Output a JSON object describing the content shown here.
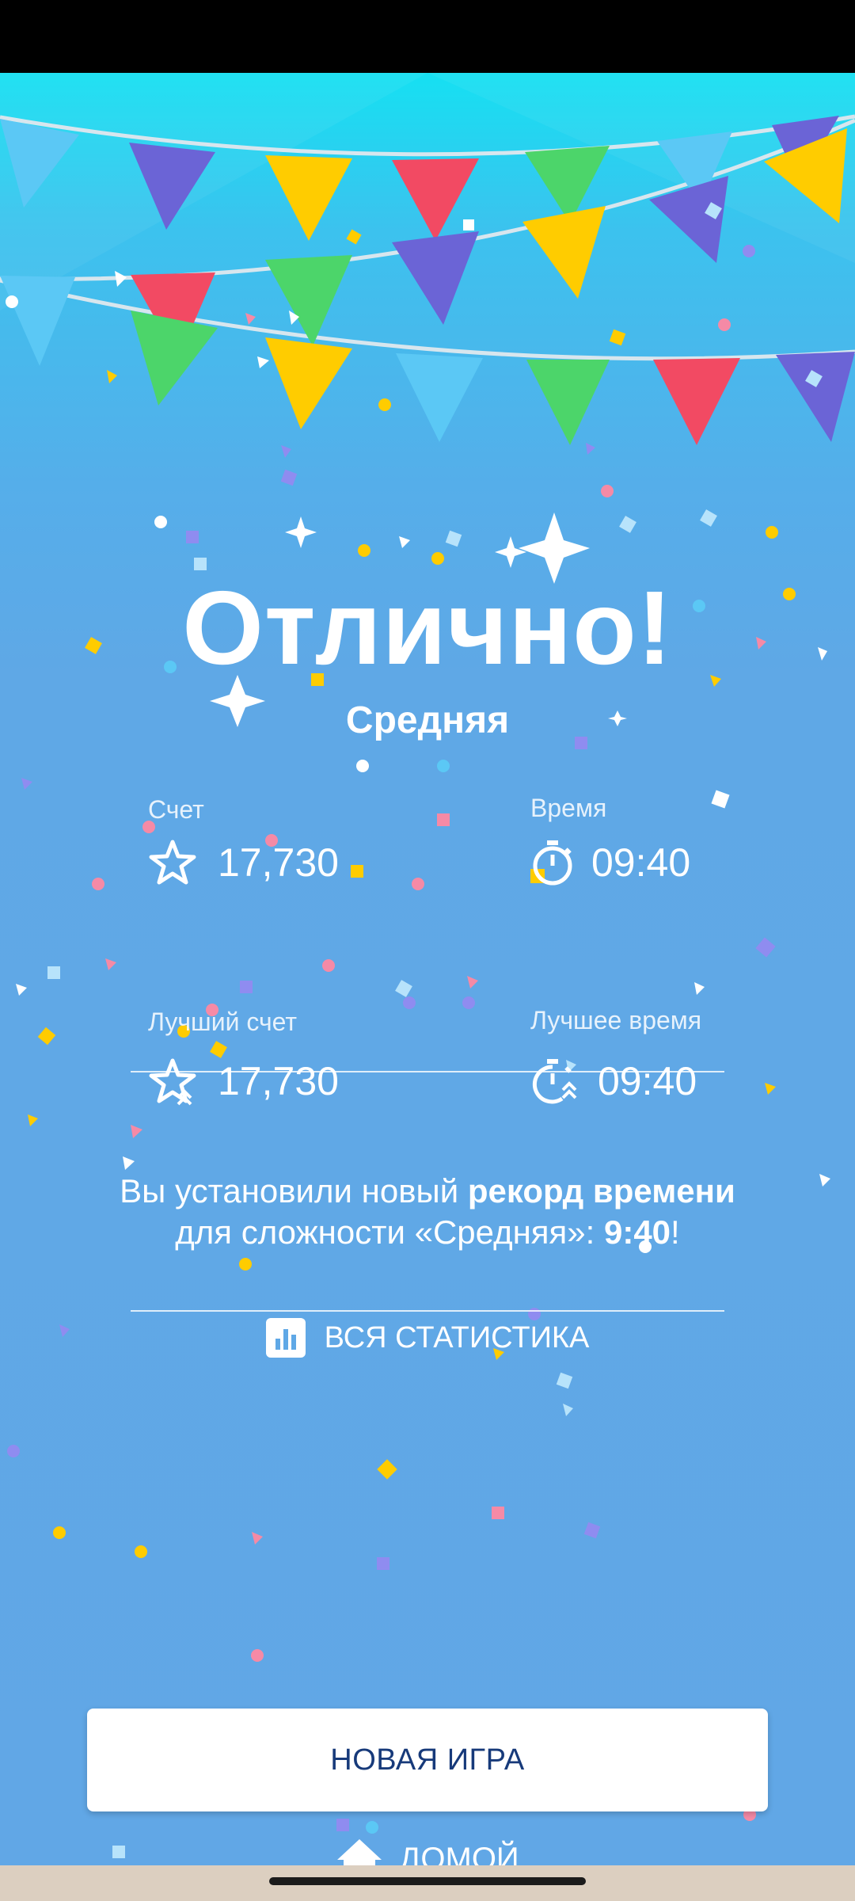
{
  "title": "Отлично!",
  "difficulty": "Средняя",
  "stats": {
    "score_label": "Счет",
    "score_value": "17,730",
    "time_label": "Время",
    "time_value": "09:40",
    "best_score_label": "Лучший счет",
    "best_score_value": "17,730",
    "best_time_label": "Лучшее время",
    "best_time_value": "09:40"
  },
  "record": {
    "prefix": "Вы установили новый ",
    "highlight": "рекорд времени",
    "middle": " для сложности «Средняя»: ",
    "time": "9:40",
    "suffix": "!"
  },
  "all_stats_label": "ВСЯ СТАТИСТИКА",
  "new_game_label": "НОВАЯ ИГРА",
  "home_label": "ДОМОЙ",
  "icons": {
    "score": "star-icon",
    "time": "stopwatch-icon",
    "best_score": "star-up-icon",
    "best_time": "stopwatch-up-icon",
    "stats": "bar-chart-icon",
    "home": "home-icon"
  },
  "colors": {
    "background": "#5fa8e6",
    "button_text": "#173a7a",
    "flag_blue": "#5bc8f5",
    "flag_purple": "#6b64d6",
    "flag_yellow": "#ffcc00",
    "flag_red": "#f24a63",
    "flag_green": "#4cd56a"
  }
}
